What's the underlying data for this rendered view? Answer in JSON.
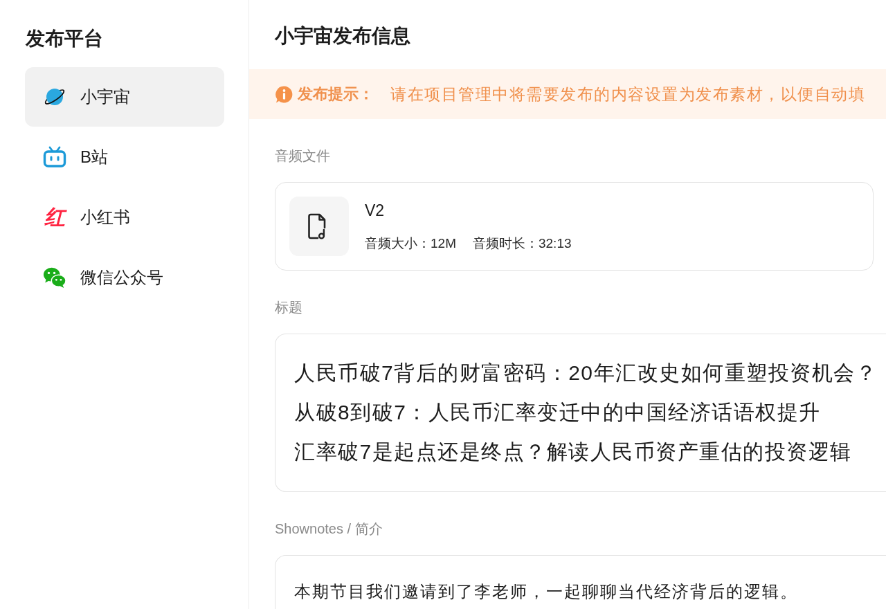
{
  "sidebar": {
    "title": "发布平台",
    "items": [
      {
        "label": "小宇宙",
        "selected": true
      },
      {
        "label": "B站",
        "selected": false
      },
      {
        "label": "小红书",
        "selected": false,
        "logo_text": "红"
      },
      {
        "label": "微信公众号",
        "selected": false
      }
    ]
  },
  "main": {
    "title": "小宇宙发布信息",
    "notice": {
      "label": "发布提示：",
      "text": "请在项目管理中将需要发布的内容设置为发布素材，以便自动填"
    },
    "audio_file": {
      "label": "音频文件",
      "name": "V2",
      "size": "音频大小：12M",
      "duration": "音频时长：32:13"
    },
    "title_field": {
      "label": "标题",
      "lines": [
        "人民币破7背后的财富密码：20年汇改史如何重塑投资机会？",
        "从破8到破7：人民币汇率变迁中的中国经济话语权提升",
        "汇率破7是起点还是终点？解读人民币资产重估的投资逻辑"
      ]
    },
    "shownotes": {
      "label": "Shownotes / 简介",
      "text": "本期节目我们邀请到了李老师，一起聊聊当代经济背后的逻辑。"
    }
  }
}
